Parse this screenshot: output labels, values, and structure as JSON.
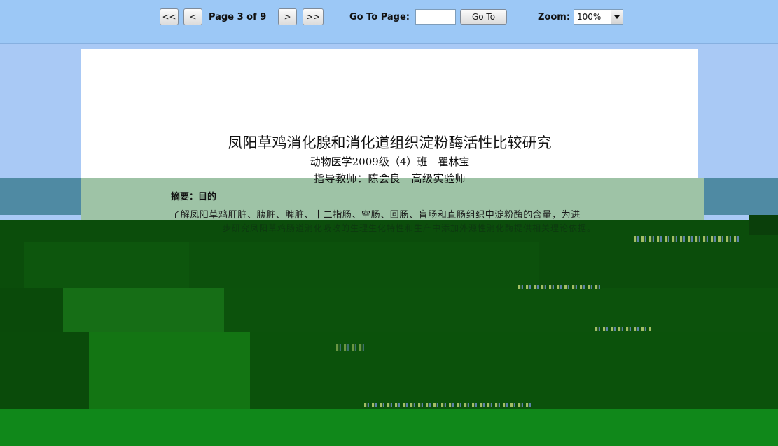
{
  "toolbar": {
    "first_label": "<<",
    "prev_label": "<",
    "page_indicator": "Page 3 of 9",
    "next_label": ">",
    "last_label": ">>",
    "goto_label": "Go To Page:",
    "goto_input_value": "",
    "goto_button_label": "Go To",
    "zoom_label": "Zoom:",
    "zoom_value": "100%"
  },
  "document": {
    "title": "凤阳草鸡消化腺和消化道组织淀粉酶活性比较研究",
    "author_line": "动物医学2009级（4）班　瞿林宝",
    "advisor_line": "指导教师：陈会良　高级实验师",
    "abstract_heading": "摘要：目的",
    "abstract_line_1": "了解凤阳草鸡肝脏、胰脏、脾脏、十二指肠、空肠、回肠、盲肠和直肠组织中淀粉酶的含量，为进",
    "abstract_line_2": "一步研究凤阳草鸡肠道消化吸收的生理生化特性和生产中添加外源性消化酶提供相关理论依据。"
  },
  "colors": {
    "toolbar_bg": "#9cc8f6",
    "viewport_bg": "#a9c9f5",
    "page_bg": "#ffffff",
    "artifact_green_dark": "#0b4d0b",
    "artifact_green": "#0f7a0f",
    "artifact_sage": "#9ec3a6",
    "artifact_teal": "#4f8aa3"
  }
}
